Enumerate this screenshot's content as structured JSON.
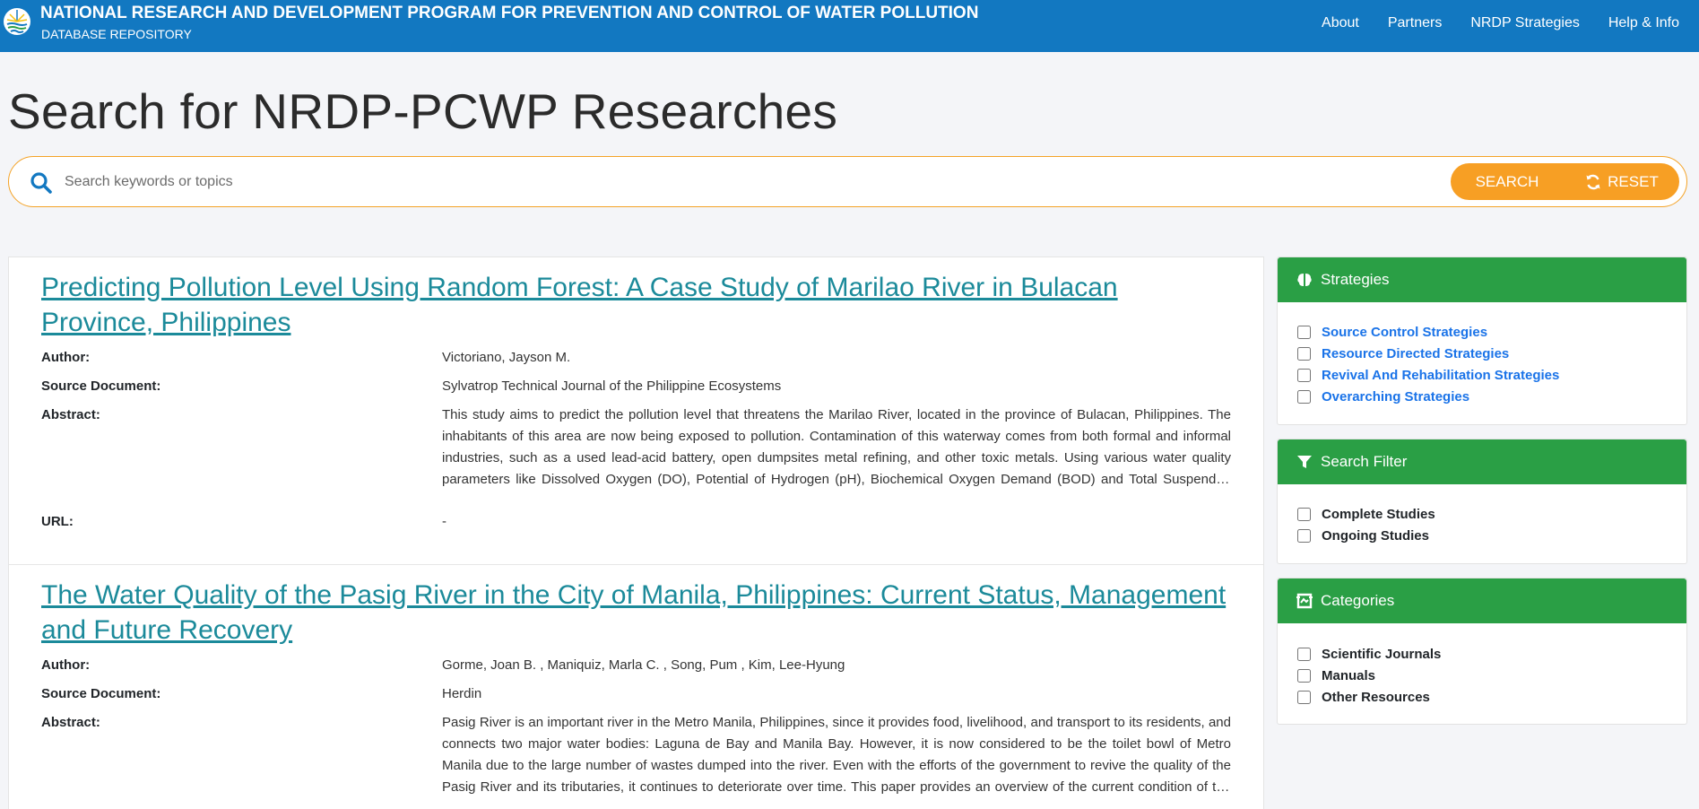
{
  "header": {
    "title": "NATIONAL RESEARCH AND DEVELOPMENT PROGRAM FOR PREVENTION AND CONTROL OF WATER POLLUTION",
    "subtitle": "DATABASE REPOSITORY",
    "nav": [
      "About",
      "Partners",
      "NRDP Strategies",
      "Help & Info"
    ]
  },
  "page_title": "Search for NRDP-PCWP Researches",
  "search": {
    "placeholder": "Search keywords or topics",
    "value": "",
    "search_label": "SEARCH",
    "reset_label": "RESET"
  },
  "results": [
    {
      "title": "Predicting Pollution Level Using Random Forest: A Case Study of Marilao River in Bulacan Province, Philippines",
      "author_label": "Author:",
      "author": "Victoriano, Jayson M.",
      "source_label": "Source Document:",
      "source": "Sylvatrop Technical Journal of the Philippine Ecosystems",
      "abstract_label": "Abstract:",
      "abstract": "This study aims to predict the pollution level that threatens the Marilao River, located in the province of Bulacan, Philippines. The inhabitants of this area are now being exposed to pollution. Contamination of this waterway comes from both formal and informal industries, such as a used lead-acid battery, open dumpsites metal refining, and other toxic metals. Using various water quality parameters like Dissolved Oxygen (DO), Potential of Hydrogen (pH), Biochemical Oxygen Demand (BOD) and Total Suspended Solids (TSS), the pollution level of the river is predicted.",
      "url_label": "URL:",
      "url": "-"
    },
    {
      "title": "The Water Quality of the Pasig River in the City of Manila, Philippines: Current Status, Management and Future Recovery",
      "author_label": "Author:",
      "author": "Gorme, Joan B. , Maniquiz, Marla C. , Song, Pum , Kim, Lee-Hyung",
      "source_label": "Source Document:",
      "source": "Herdin",
      "abstract_label": "Abstract:",
      "abstract": "Pasig River is an important river in the Metro Manila, Philippines, since it provides food, livelihood, and transport to its residents, and connects two major water bodies: Laguna de Bay and Manila Bay. However, it is now considered to be the toilet bowl of Metro Manila due to the large number of wastes dumped into the river. Even with the efforts of the government to revive the quality of the Pasig River and its tributaries, it continues to deteriorate over time. This paper provides an overview of the current condition of the Pasig River."
    }
  ],
  "sidebar": {
    "strategies": {
      "title": "Strategies",
      "icon": "brain-icon",
      "items": [
        "Source Control Strategies",
        "Resource Directed Strategies",
        "Revival And Rehabilitation Strategies",
        "Overarching Strategies"
      ]
    },
    "filter": {
      "title": "Search Filter",
      "icon": "filter-icon",
      "items": [
        "Complete Studies",
        "Ongoing Studies"
      ]
    },
    "categories": {
      "title": "Categories",
      "icon": "categories-icon",
      "items": [
        "Scientific Journals",
        "Manuals",
        "Other Resources"
      ]
    }
  },
  "colors": {
    "header_blue": "#1278c1",
    "accent_orange": "#f79f24",
    "panel_green": "#2a9f45",
    "title_teal": "#1b8a9a",
    "link_blue": "#1a73e8"
  }
}
